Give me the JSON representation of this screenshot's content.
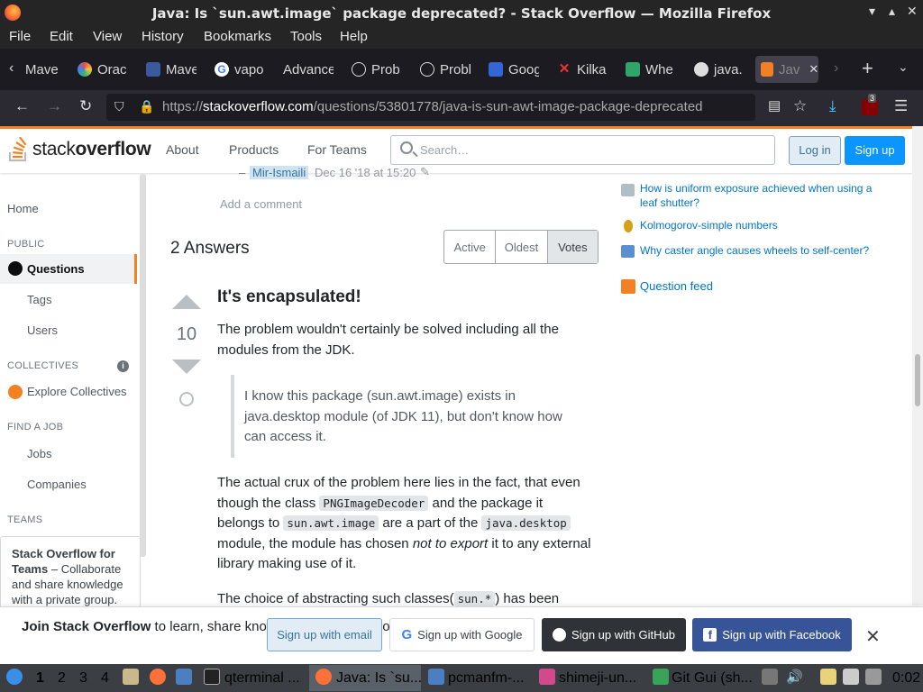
{
  "window": {
    "title": "Java: Is `sun.awt.image` package deprecated? - Stack Overflow — Mozilla Firefox"
  },
  "menubar": [
    "File",
    "Edit",
    "View",
    "History",
    "Bookmarks",
    "Tools",
    "Help"
  ],
  "tabs": [
    {
      "label": "Mave"
    },
    {
      "label": "Orac"
    },
    {
      "label": "Mave"
    },
    {
      "label": "vapo"
    },
    {
      "label": "Advance"
    },
    {
      "label": "Prob"
    },
    {
      "label": "Probl"
    },
    {
      "label": "Goog"
    },
    {
      "label": "Kilka"
    },
    {
      "label": "Whe"
    },
    {
      "label": "java."
    },
    {
      "label": "Jav"
    }
  ],
  "nav": {
    "url_prefix": "https://",
    "url_domain": "stackoverflow.com",
    "url_path": "/questions/53801778/java-is-sun-awt-image-package-deprecated",
    "ublock_badge": "3"
  },
  "so_header": {
    "logo_text_light": "stack",
    "logo_text_bold": "overflow",
    "about": "About",
    "products": "Products",
    "for_teams": "For Teams",
    "search_placeholder": "Search…",
    "login": "Log in",
    "signup": "Sign up"
  },
  "left_nav": {
    "home": "Home",
    "public": "PUBLIC",
    "questions": "Questions",
    "tags": "Tags",
    "users": "Users",
    "collectives": "COLLECTIVES",
    "explore_collectives": "Explore Collectives",
    "find_a_job": "FIND A JOB",
    "jobs": "Jobs",
    "companies": "Companies",
    "teams": "TEAMS",
    "teams_box_title": "Stack Overflow for Teams",
    "teams_box_text": " – Collaborate and share knowledge with a private group."
  },
  "comment": {
    "dash": "–",
    "user": "Mir-Ismaili",
    "date": "Dec 16 '18 at 15:20",
    "add_comment": "Add a comment"
  },
  "answers": {
    "count_label": "2 Answers",
    "sort": [
      "Active",
      "Oldest",
      "Votes"
    ]
  },
  "answer": {
    "votes": "10",
    "title": "It's encapsulated!",
    "p1": "The problem wouldn't certainly be solved including all the modules from the JDK.",
    "quote": "I know this package (sun.awt.image) exists in java.desktop module (of JDK 11), but don't know how can access it.",
    "p2_a": "The actual crux of the problem here lies in the fact, that even though the class ",
    "p2_code1": "PNGImageDecoder",
    "p2_b": " and the package it belongs to ",
    "p2_code2": "sun.awt.image",
    "p2_c": " are a part of the ",
    "p2_code3": "java.desktop",
    "p2_d": " module, the module has chosen ",
    "p2_em": "not to export",
    "p2_e": " it to any external library making use of it.",
    "p3_a": "The choice of abstracting such classes(",
    "p3_code": "sun.*",
    "p3_b": ") has been"
  },
  "right_sidebar": {
    "links": [
      "How is uniform exposure achieved when using a leaf shutter?",
      "Kolmogorov-simple numbers",
      "Why caster angle causes wheels to self-center?"
    ],
    "question_feed": "Question feed"
  },
  "banner": {
    "bold": "Join Stack Overflow",
    "text": " to learn, share knowledge, and build your career.",
    "email": "Sign up with email",
    "google": "Sign up with Google",
    "github": "Sign up with GitHub",
    "facebook": "Sign up with Facebook"
  },
  "taskbar": {
    "workspaces": [
      "1",
      "2",
      "3",
      "4"
    ],
    "apps": [
      "qterminal ...",
      "Java: Is `su...",
      "pcmanfm-...",
      "shimeji-un...",
      "Git Gui (sh..."
    ],
    "clock": "0:02"
  },
  "colors": {
    "accent": "#f48024",
    "link": "#0074cc",
    "primary_button": "#0a95ff"
  }
}
